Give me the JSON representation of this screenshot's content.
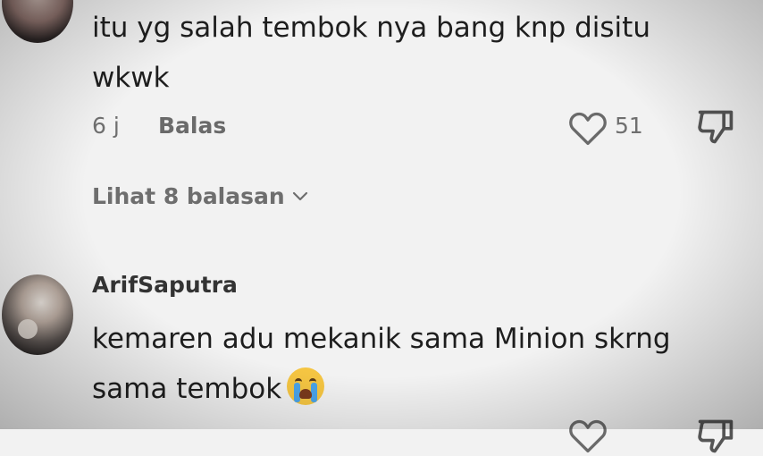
{
  "comments": [
    {
      "text_line1": "itu yg salah tembok nya bang knp disitu",
      "text_line2": "wkwk",
      "time": "6 j",
      "reply_label": "Balas",
      "likes": "51",
      "view_replies": "Lihat 8 balasan"
    },
    {
      "username": "ArifSaputra",
      "text_line1": "kemaren adu mekanik sama Minion skrng",
      "text_line2": "sama tembok"
    }
  ],
  "icons": {
    "like": "heart-icon",
    "dislike": "thumbs-down-icon",
    "expand": "chevron-down-icon",
    "emoji": "crying-face-emoji"
  }
}
